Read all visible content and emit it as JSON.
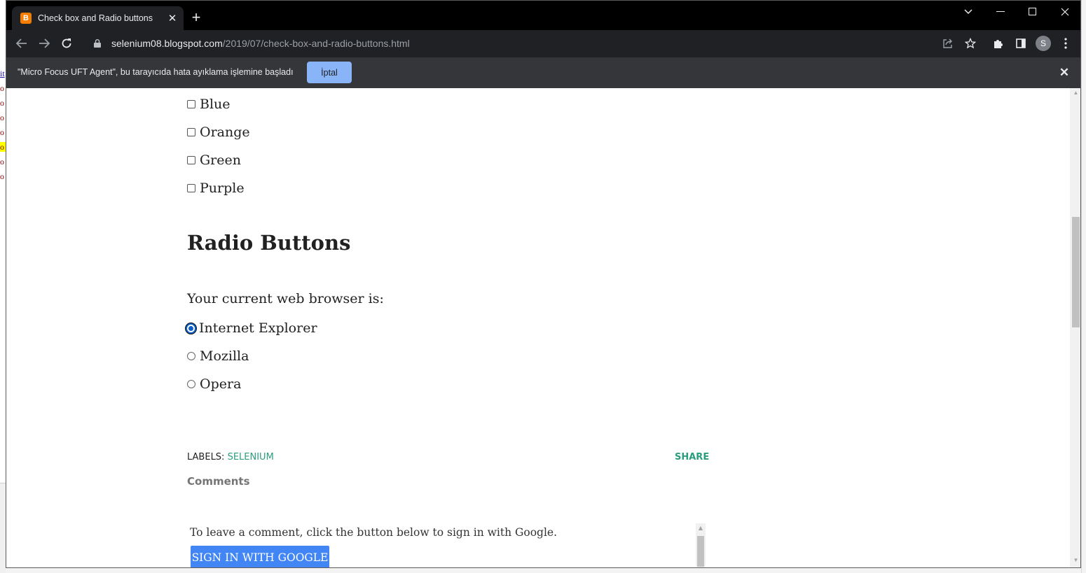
{
  "browser": {
    "tab_title": "Check box and Radio buttons",
    "tab_favicon_letter": "B",
    "new_tab_glyph": "+",
    "url_host": "selenium08.blogspot.com",
    "url_path": "/2019/07/check-box-and-radio-buttons.html",
    "profile_initial": "S",
    "accent_color": "#8ab4f8"
  },
  "infobar": {
    "message": "\"Micro Focus UFT Agent\", bu tarayıcıda hata ayıklama işlemine başladı",
    "cancel_label": "İptal"
  },
  "page": {
    "checkboxes": [
      {
        "label": "Blue",
        "checked": false
      },
      {
        "label": "Orange",
        "checked": false
      },
      {
        "label": "Green",
        "checked": false
      },
      {
        "label": "Purple",
        "checked": false
      }
    ],
    "radio_heading": "Radio Buttons",
    "radio_question": "Your current web browser is:",
    "radios": [
      {
        "label": "Internet Explorer",
        "checked": true
      },
      {
        "label": "Mozilla",
        "checked": false
      },
      {
        "label": "Opera",
        "checked": false
      }
    ],
    "labels_prefix": "LABELS: ",
    "labels_value": "SELENIUM",
    "share_label": "SHARE",
    "comments_heading": "Comments",
    "comment_instruction": "To leave a comment, click the button below to sign in with Google.",
    "signin_label": "SIGN IN WITH GOOGLE",
    "link_color": "#2a9d7e"
  },
  "behind_window_chars": [
    "it",
    "o",
    "o",
    "o",
    "o",
    "o",
    "o",
    "o"
  ]
}
